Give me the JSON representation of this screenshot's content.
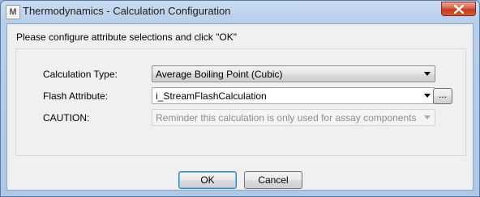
{
  "window": {
    "title": "Thermodynamics - Calculation Configuration",
    "app_icon_glyph": "M",
    "close_icon": "close-icon"
  },
  "instruction": "Please configure attribute selections and click \"OK\"",
  "form": {
    "calculation_type": {
      "label": "Calculation Type:",
      "value": "Average Boiling Point  (Cubic)"
    },
    "flash_attribute": {
      "label": "Flash Attribute:",
      "value": "i_StreamFlashCalculation",
      "browse_label": "..."
    },
    "caution": {
      "label": "CAUTION:",
      "value": "Reminder this calculation is only used for assay components"
    }
  },
  "buttons": {
    "ok": "OK",
    "cancel": "Cancel"
  },
  "colors": {
    "close_button": "#c5391c",
    "title_bar": "#b7cfeb",
    "dialog_bg": "#f0f0f0",
    "default_button_border": "#3c7fb1"
  }
}
